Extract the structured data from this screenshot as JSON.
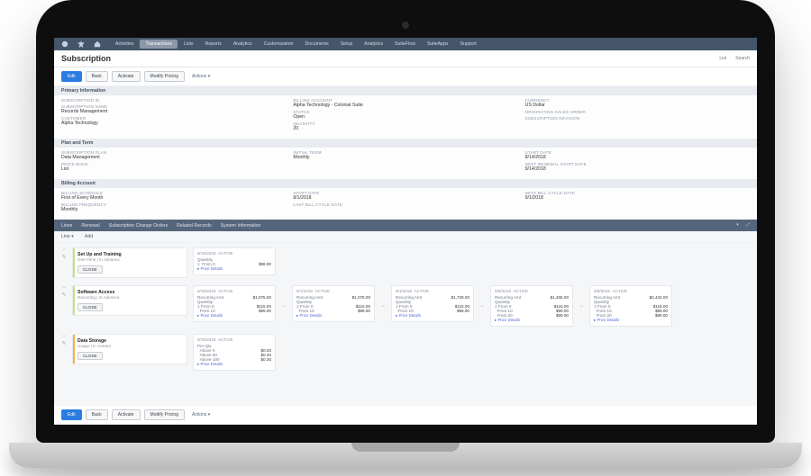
{
  "nav": {
    "tabs": [
      "Activities",
      "Transactions",
      "Lists",
      "Reports",
      "Analytics",
      "Customization",
      "Documents",
      "Setup",
      "Analytics",
      "SuiteFlow",
      "SuiteApps",
      "Support"
    ]
  },
  "page": {
    "title": "Subscription",
    "header_links": [
      "List",
      "Search"
    ]
  },
  "buttons": {
    "edit": "Edit",
    "back": "Back",
    "activate": "Activate",
    "modify": "Modify Pricing",
    "actions": "Actions"
  },
  "sections": {
    "primary": {
      "title": "Primary Information",
      "col1": [
        {
          "label": "SUBSCRIPTION ID",
          "value": ""
        },
        {
          "label": "SUBSCRIPTION NAME",
          "value": "Records Management"
        },
        {
          "label": "CUSTOMER",
          "value": "Alpha Technology"
        }
      ],
      "col2": [
        {
          "label": "BILLING ACCOUNT",
          "value": "Alpha Technology · Colonial Suite"
        },
        {
          "label": "STATUS",
          "value": "Open"
        },
        {
          "label": "QUANTITY",
          "value": "20"
        }
      ],
      "col3": [
        {
          "label": "CURRENCY",
          "value": "US Dollar"
        },
        {
          "label": "ORIGINATING SALES ORDER",
          "value": ""
        },
        {
          "label": "SUBSCRIPTION REVISION",
          "value": ""
        }
      ]
    },
    "plan": {
      "title": "Plan and Term",
      "col1": [
        {
          "label": "SUBSCRIPTION PLAN",
          "value": "Data Management"
        },
        {
          "label": "PRICE BOOK",
          "value": "List"
        }
      ],
      "col2": [
        {
          "label": "INITIAL TERM",
          "value": "Monthly"
        }
      ],
      "col3": [
        {
          "label": "START DATE",
          "value": "8/14/2018"
        },
        {
          "label": "NEXT RENEWAL START DATE",
          "value": "9/14/2018"
        }
      ]
    },
    "billing": {
      "title": "Billing Account",
      "col1": [
        {
          "label": "BILLING SCHEDULE",
          "value": "First of Every Month"
        },
        {
          "label": "BILLING FREQUENCY",
          "value": "Monthly"
        }
      ],
      "col2": [
        {
          "label": "START DATE",
          "value": "8/1/2018"
        },
        {
          "label": "LAST BILL CYCLE DATE",
          "value": ""
        }
      ],
      "col3": [
        {
          "label": "NEXT BILL CYCLE DATE",
          "value": "9/1/2018"
        }
      ]
    }
  },
  "subtabs": {
    "items": [
      "Lines",
      "Renewal",
      "Subscription Change Orders",
      "Related Records",
      "System Information"
    ]
  },
  "lines": {
    "tabs": [
      "Line ▾",
      "Add"
    ],
    "close_label": "CLOSE",
    "active_label": "ACTIVE",
    "details_label": "Price Details",
    "qty_label": "Quantity",
    "rec_label": "Recurring Amt",
    "perqty_label": "Per Qty",
    "from_label": "From",
    "above_label": "Above",
    "items": [
      {
        "name": "Set Up and Training",
        "sub": "One-Time | In Advance",
        "periods": [
          {
            "date": "8/15/2018",
            "amount": "$99.00"
          }
        ]
      },
      {
        "name": "Software Access",
        "sub": "Recurring | In Advance",
        "periods": [
          {
            "date": "8/15/2018",
            "amount": "$1,075.00",
            "p1": "$115.00",
            "p2": "$99.00"
          },
          {
            "date": "9/1/2018",
            "amount": "$1,075.00",
            "p1": "$115.00",
            "p2": "$99.00"
          },
          {
            "date": "9/1/2018",
            "amount": "$1,729.00",
            "p1": "$115.00",
            "p2": "$99.00"
          },
          {
            "date": "9/8/2018",
            "amount": "$1,465.00",
            "p1": "$115.00",
            "p2": "$99.00",
            "p3": "$89.00"
          },
          {
            "date": "9/8/2018",
            "amount": "$2,442.00",
            "p1": "$115.00",
            "p2": "$99.00",
            "p3": "$89.00"
          }
        ]
      },
      {
        "name": "Data Storage",
        "sub": "Usage | In Arrears",
        "periods": [
          {
            "date": "8/15/2018",
            "t1": "$0.00",
            "t2": "$0.40",
            "t3": "$0.30"
          }
        ]
      }
    ]
  }
}
